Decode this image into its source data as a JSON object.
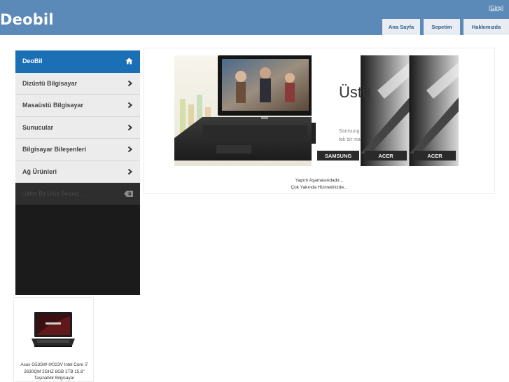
{
  "header": {
    "logo": "Deobil",
    "login_open": "[",
    "login_label": "Giriş",
    "login_close": "]",
    "tabs": [
      "Ana Sayfa",
      "Sepetim",
      "Hakkımızda"
    ]
  },
  "colors": {
    "header_bg": "#5b89b8",
    "active_menu": "#1a6fb5",
    "tab_text": "#2d5a88",
    "sidebar_dark": "#1b1b1b"
  },
  "sidebar": {
    "items": [
      {
        "label": "DeoBil",
        "icon": "home-icon"
      },
      {
        "label": "Dizüstü Bilgisayar",
        "icon": "chevron-right-icon"
      },
      {
        "label": "Masaüstü Bilgisayar",
        "icon": "chevron-right-icon"
      },
      {
        "label": "Sunucular",
        "icon": "chevron-right-icon"
      },
      {
        "label": "Bilgisayar Bileşenleri",
        "icon": "chevron-right-icon"
      },
      {
        "label": "Ağ Ürünleri",
        "icon": "chevron-right-icon"
      }
    ],
    "search_placeholder": "Lütfen Bir Ürün Seçiniz ...",
    "search_icon": "backspace-icon"
  },
  "slider": {
    "headline": "Üstü",
    "subtext_line1": "Samsung",
    "subtext_line2": "tek bir ma",
    "thumbs": [
      "SAMSUNG",
      "ACER",
      "ACER"
    ]
  },
  "main": {
    "notice_line1": "Yapım Aşamasındadır...",
    "notice_line2": "Çok Yakında Hizmetinizde..."
  },
  "product": {
    "title": "Asus G53SW-IX023V Intel Core i7 2630QM 2GHZ 8GB 1TB 15.6\" Taşınabilir Bilgisayar"
  }
}
